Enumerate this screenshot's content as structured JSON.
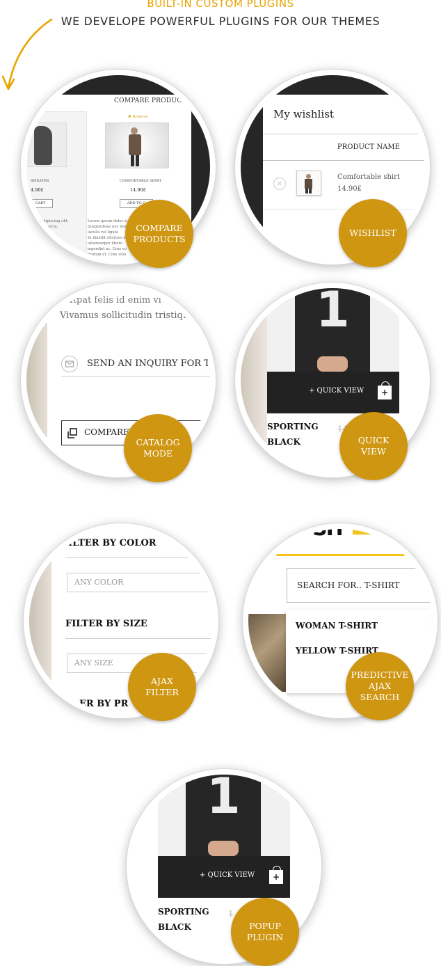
{
  "header": {
    "eyebrow": "BUILT-IN CUSTOM PLUGINS",
    "subtitle": "WE DEVELOPE POWERFUL PLUGINS FOR OUR THEMES"
  },
  "accent_color": "#cf9612",
  "compare": {
    "badge": "COMPARE\nPRODUCTS",
    "title": "COMPARE PRODUCT",
    "remove": "✖ Remove",
    "left_name": "SWEATER",
    "left_price": "4.90£",
    "left_button": "CART",
    "right_name": "COMFORTABLE SHIRT",
    "right_price": "14.90£",
    "right_button": "ADD TO C",
    "left_text": "tetur adipiscing elit.\nbulum viverra,",
    "right_text": "Lorem ipsum dolor si\nSuspendisse nec nisi\niaculis vel ligula\nIn blandit ultricies e\nullamcorper libero\nmperdiet ac. Cras vo\nbisdum et. Cras volu"
  },
  "wishlist": {
    "badge": "WISHLIST",
    "title": "My wishlist",
    "column": "PRODUCT NAME",
    "item_name": "Comfortable shirt",
    "item_price": "14.90£"
  },
  "catalog": {
    "badge": "CATALOG\nMODE",
    "line1": "...utpat felis id enim vi",
    "line2": "Vivamus sollicitudin tristiqu",
    "inquiry": "SEND AN INQUIRY FOR TH",
    "compare": "COMPARE"
  },
  "quickview": {
    "badge": "QUICK\nVIEW",
    "button": "+ QUICK VIEW",
    "name1": "SPORTING",
    "name2": "BLACK",
    "price": "14",
    "number": "1"
  },
  "ajax_filter": {
    "badge": "AJAX\nFILTER",
    "color_title": "ILTER BY COLOR",
    "color_placeholder": "ANY COLOR",
    "size_title": "FILTER BY SIZE",
    "size_placeholder": "ANY SIZE",
    "price_title": "ER BY PR"
  },
  "predictive": {
    "badge": "PREDICTIVE\nAJAX\nSEARCH",
    "logo": "SH",
    "search_value": "SEARCH FOR..  T-SHIRT",
    "suggestion1": "WOMAN T-SHIRT",
    "suggestion2": "YELLOW T-SHIRT"
  },
  "popup": {
    "badge": "POPUP\nPLUGIN",
    "button": "+ QUICK VIEW",
    "name1": "SPORTING",
    "name2": "BLACK",
    "price": "1",
    "number": "1"
  }
}
